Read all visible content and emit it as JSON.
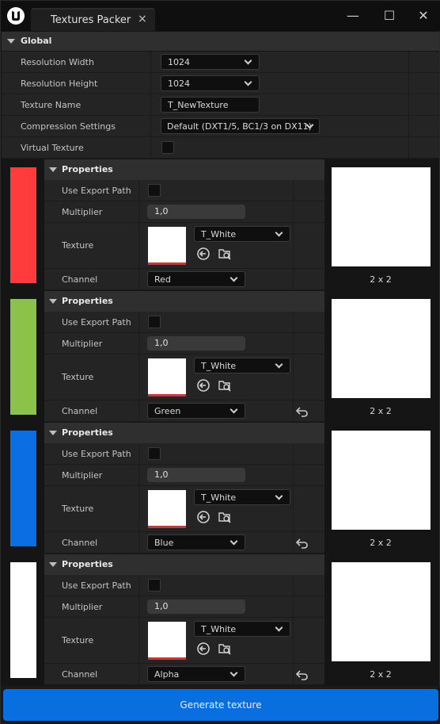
{
  "window": {
    "tab_title": "Textures Packer",
    "tab_close": "×",
    "minimize": "—",
    "maximize": "☐",
    "close": "✕"
  },
  "global": {
    "header": "Global",
    "rows": [
      {
        "label": "Resolution Width",
        "value": "1024"
      },
      {
        "label": "Resolution Height",
        "value": "1024"
      },
      {
        "label": "Texture Name",
        "value": "T_NewTexture"
      },
      {
        "label": "Compression Settings",
        "value": "Default (DXT1/5, BC1/3 on DX11)"
      },
      {
        "label": "Virtual Texture",
        "value": ""
      }
    ]
  },
  "channels": [
    {
      "color": "#ff3b3b",
      "header": "Properties",
      "use_export_path_label": "Use Export Path",
      "multiplier_label": "Multiplier",
      "multiplier": "1,0",
      "texture_label": "Texture",
      "texture_value": "T_White",
      "channel_label": "Channel",
      "channel_value": "Red",
      "preview_size": "2 x 2"
    },
    {
      "color": "#8bc34a",
      "header": "Properties",
      "use_export_path_label": "Use Export Path",
      "multiplier_label": "Multiplier",
      "multiplier": "1,0",
      "texture_label": "Texture",
      "texture_value": "T_White",
      "channel_label": "Channel",
      "channel_value": "Green",
      "preview_size": "2 x 2"
    },
    {
      "color": "#0b6ee3",
      "header": "Properties",
      "use_export_path_label": "Use Export Path",
      "multiplier_label": "Multiplier",
      "multiplier": "1,0",
      "texture_label": "Texture",
      "texture_value": "T_White",
      "channel_label": "Channel",
      "channel_value": "Blue",
      "preview_size": "2 x 2"
    },
    {
      "color": "#ffffff",
      "header": "Properties",
      "use_export_path_label": "Use Export Path",
      "multiplier_label": "Multiplier",
      "multiplier": "1,0",
      "texture_label": "Texture",
      "texture_value": "T_White",
      "channel_label": "Channel",
      "channel_value": "Alpha",
      "preview_size": "2 x 2"
    }
  ],
  "generate_button": "Generate texture"
}
